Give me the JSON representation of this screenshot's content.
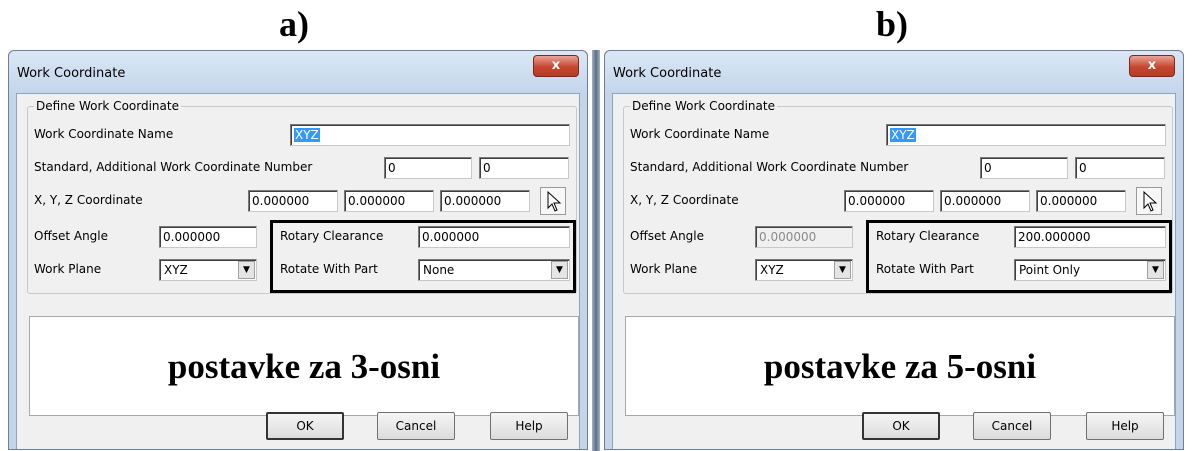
{
  "panels": [
    {
      "label": "a)",
      "window_title": "Work Coordinate",
      "close_label": "x",
      "group_title": "Define Work Coordinate",
      "name_label": "Work Coordinate Name",
      "name_value": "XYZ",
      "number_label": "Standard, Additional Work Coordinate Number",
      "number_values": [
        "0",
        "0"
      ],
      "xyz_label": "X, Y, Z Coordinate",
      "xyz_values": [
        "0.000000",
        "0.000000",
        "0.000000"
      ],
      "offset_label": "Offset Angle",
      "offset_value": "0.000000",
      "offset_disabled": false,
      "work_plane_label": "Work Plane",
      "work_plane_value": "XYZ",
      "rotary_label": "Rotary Clearance",
      "rotary_value": "0.000000",
      "rotate_label": "Rotate With Part",
      "rotate_value": "None",
      "note": "postavke za 3-osni",
      "buttons": {
        "ok": "OK",
        "cancel": "Cancel",
        "help": "Help"
      }
    },
    {
      "label": "b)",
      "window_title": "Work Coordinate",
      "close_label": "x",
      "group_title": "Define Work Coordinate",
      "name_label": "Work Coordinate Name",
      "name_value": "XYZ",
      "number_label": "Standard, Additional Work Coordinate Number",
      "number_values": [
        "0",
        "0"
      ],
      "xyz_label": "X, Y, Z Coordinate",
      "xyz_values": [
        "0.000000",
        "0.000000",
        "0.000000"
      ],
      "offset_label": "Offset Angle",
      "offset_value": "0.000000",
      "offset_disabled": true,
      "work_plane_label": "Work Plane",
      "work_plane_value": "XYZ",
      "rotary_label": "Rotary Clearance",
      "rotary_value": "200.000000",
      "rotate_label": "Rotate With Part",
      "rotate_value": "Point Only",
      "note": "postavke za 5-osni",
      "buttons": {
        "ok": "OK",
        "cancel": "Cancel",
        "help": "Help"
      }
    }
  ],
  "icons": {
    "pick": "pointer-arrow-icon",
    "dropdown": "chevron-down-icon",
    "close": "close-icon"
  },
  "colors": {
    "selection": "#3399ff",
    "close_button": "#c6462f",
    "frame": "#c4d5e9"
  }
}
